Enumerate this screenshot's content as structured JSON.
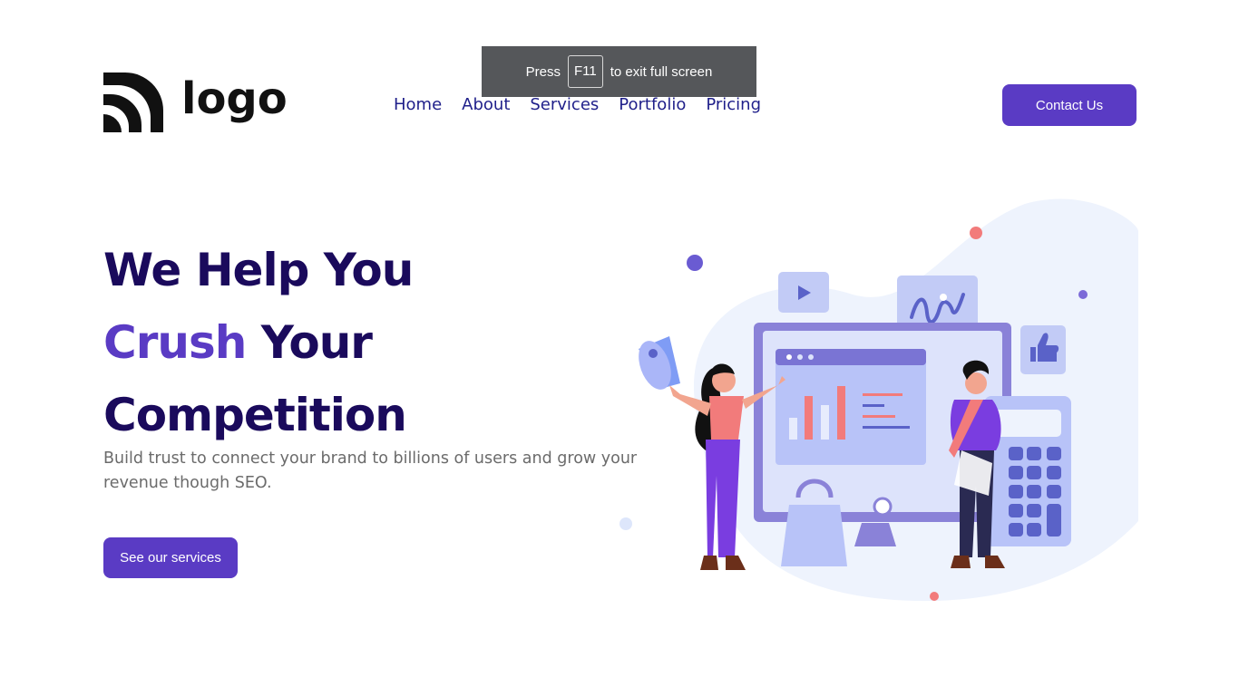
{
  "brand": {
    "logo_text": "logo"
  },
  "nav": {
    "items": [
      {
        "label": "Home"
      },
      {
        "label": "About"
      },
      {
        "label": "Services"
      },
      {
        "label": "Portfolio"
      },
      {
        "label": "Pricing"
      }
    ]
  },
  "fullscreen_notice": {
    "prefix": "Press",
    "key": "F11",
    "suffix": "to exit full screen"
  },
  "header": {
    "contact_label": "Contact Us"
  },
  "hero": {
    "title_line1": "We Help You",
    "title_accent": "Crush",
    "title_line2_rest": "Your",
    "title_line3": "Competition",
    "subtitle": "Build trust to connect your brand to billions of users and grow your revenue though SEO.",
    "cta_label": "See our services"
  },
  "colors": {
    "primary": "#5a3bc4",
    "heading": "#1a0a5c",
    "nav_text": "#1f1f8a",
    "body_text": "#6b6b6b"
  }
}
